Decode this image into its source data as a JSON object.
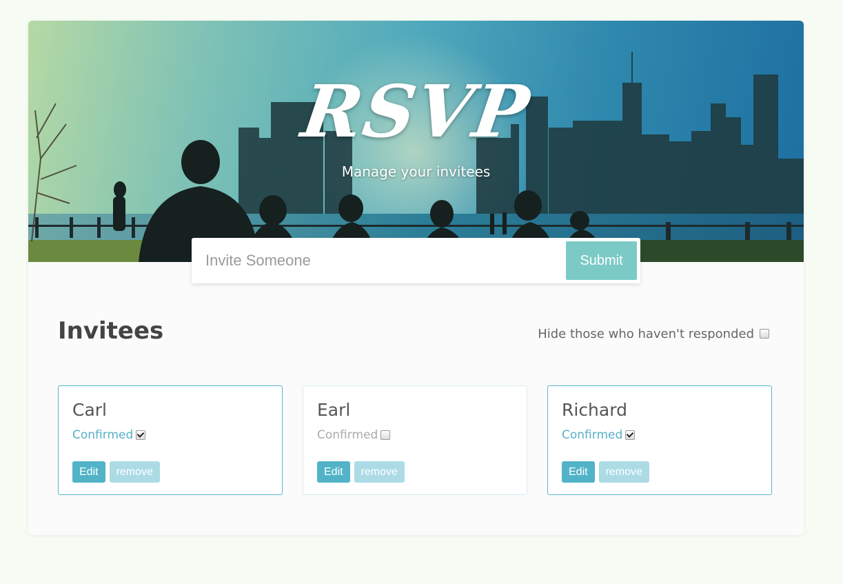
{
  "header": {
    "logo": "RSVP",
    "tagline": "Manage your invitees"
  },
  "invite_form": {
    "placeholder": "Invite Someone",
    "submit_label": "Submit"
  },
  "invitees_section": {
    "title": "Invitees",
    "filter_label": "Hide those who haven't responded",
    "filter_checked": false
  },
  "invitees": [
    {
      "name": "Carl",
      "status_label": "Confirmed",
      "confirmed": true,
      "edit_label": "Edit",
      "remove_label": "remove"
    },
    {
      "name": "Earl",
      "status_label": "Confirmed",
      "confirmed": false,
      "edit_label": "Edit",
      "remove_label": "remove"
    },
    {
      "name": "Richard",
      "status_label": "Confirmed",
      "confirmed": true,
      "edit_label": "Edit",
      "remove_label": "remove"
    }
  ],
  "colors": {
    "page_background": "#f6fbf3",
    "accent": "#56afc9",
    "submit": "#7ccac5",
    "edit_button": "#52b3c8",
    "remove_button": "#acdbe6"
  }
}
